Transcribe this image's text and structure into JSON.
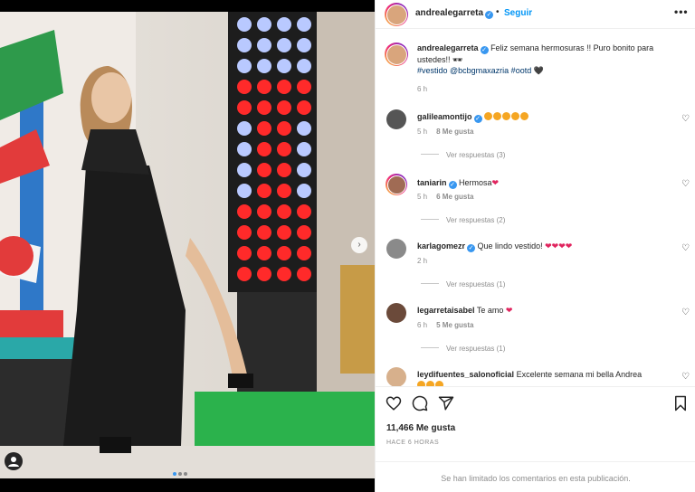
{
  "header": {
    "username": "andrealegarreta",
    "follow_label": "Seguir",
    "separator": "•",
    "more": "•••"
  },
  "caption": {
    "username": "andrealegarreta",
    "text": "Feliz semana hermosuras !! Puro bonito para ustedes!! 🕶",
    "hashtags": "#vestido @bcbgmaxazria #ootd",
    "time": "6 h"
  },
  "comments": [
    {
      "username": "galileamontijo",
      "verified": true,
      "text": "",
      "time": "5 h",
      "likes": "8 Me gusta",
      "replies": "Ver respuestas (3)"
    },
    {
      "username": "taniarin",
      "verified": true,
      "text": "Hermosa",
      "time": "5 h",
      "likes": "6 Me gusta",
      "replies": "Ver respuestas (2)"
    },
    {
      "username": "karlagomezr",
      "verified": true,
      "text": "Que lindo vestido!",
      "time": "2 h",
      "likes": "",
      "replies": "Ver respuestas (1)"
    },
    {
      "username": "legarretaisabel",
      "verified": false,
      "text": "Te amo",
      "time": "6 h",
      "likes": "5 Me gusta",
      "replies": "Ver respuestas (1)"
    },
    {
      "username": "leydifuentes_salonoficial",
      "verified": false,
      "text": "Excelente semana mi bella Andrea",
      "time": "",
      "likes": "",
      "replies": ""
    }
  ],
  "actions": {
    "likes": "11,466 Me gusta",
    "time": "HACE 6 HORAS"
  },
  "footer": {
    "notice": "Se han limitado los comentarios en esta publicación."
  },
  "icons": {
    "like": "heart-icon",
    "comment": "comment-icon",
    "share": "share-icon",
    "save": "bookmark-icon"
  },
  "colors": {
    "link": "#0095f6",
    "verified": "#3897f0",
    "muted": "#8e8e8e"
  }
}
